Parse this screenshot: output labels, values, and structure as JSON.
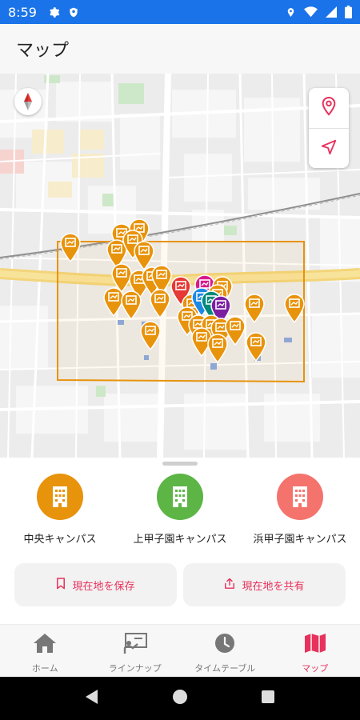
{
  "status_bar": {
    "time": "8:59",
    "left_icons": [
      "gear-icon",
      "shield-icon"
    ],
    "right_icons": [
      "location-icon",
      "wifi-icon",
      "signal-icon",
      "battery-icon"
    ]
  },
  "app_bar": {
    "title": "マップ"
  },
  "map": {
    "controls": [
      "location-pin-icon",
      "navigation-arrow-icon"
    ],
    "compass": "compass-icon"
  },
  "campuses": [
    {
      "label": "中央キャンパス",
      "color": "#e8930c",
      "icon": "building-icon"
    },
    {
      "label": "上甲子園キャンパス",
      "color": "#5cb545",
      "icon": "building-icon"
    },
    {
      "label": "浜甲子園キャンパス",
      "color": "#f5736d",
      "icon": "building-icon"
    }
  ],
  "actions": {
    "save_label": "現在地を保存",
    "share_label": "現在地を共有"
  },
  "bottom_nav": [
    {
      "label": "ホーム",
      "icon": "home-icon",
      "active": false
    },
    {
      "label": "ラインナップ",
      "icon": "presentation-icon",
      "active": false
    },
    {
      "label": "タイムテーブル",
      "icon": "clock-icon",
      "active": false
    },
    {
      "label": "マップ",
      "icon": "map-icon",
      "active": true
    }
  ],
  "colors": {
    "accent": "#e8315c",
    "status_bar": "#1a73e8",
    "pin_orange": "#e8930c",
    "area_outline": "#e8930c"
  }
}
